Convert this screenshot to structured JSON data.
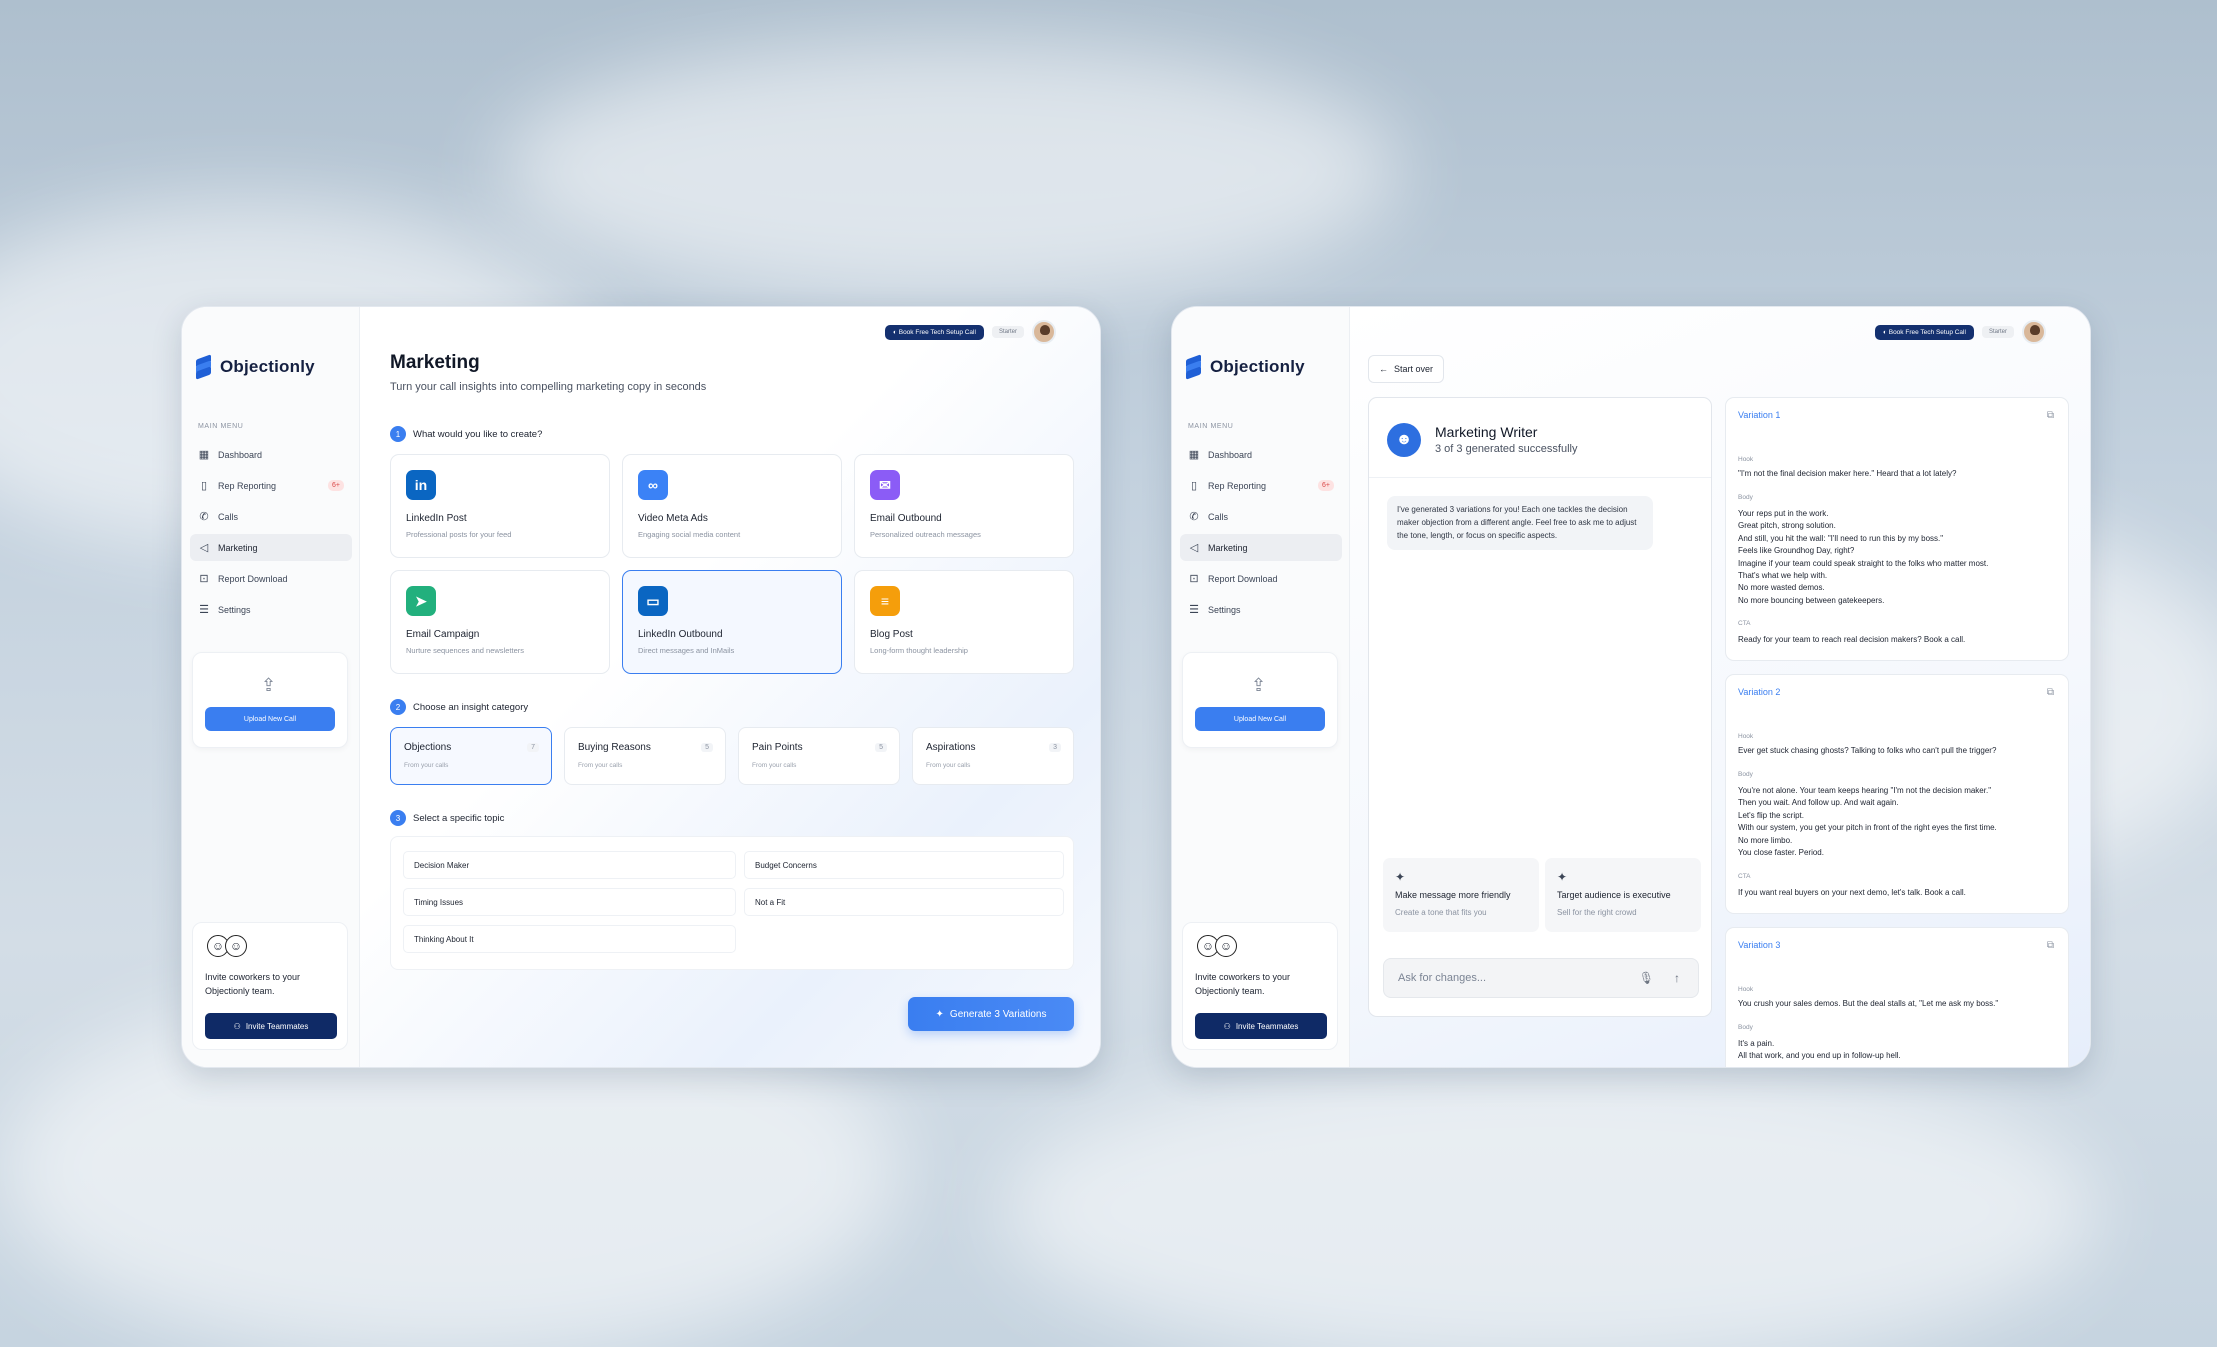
{
  "brand": {
    "name": "Objectionly",
    "accent": "#3a7ef0",
    "navy": "#0f2a66"
  },
  "topbar": {
    "book_call": "Book Free Tech Setup Call",
    "plan": "Starter"
  },
  "sidebar": {
    "menu_title": "MAIN MENU",
    "items": [
      {
        "label": "Dashboard",
        "icon": "grid-icon"
      },
      {
        "label": "Rep Reporting",
        "icon": "book-icon",
        "badge": "6+"
      },
      {
        "label": "Calls",
        "icon": "phone-icon"
      },
      {
        "label": "Marketing",
        "icon": "megaphone-icon",
        "active": true
      },
      {
        "label": "Report Download",
        "icon": "download-icon"
      },
      {
        "label": "Settings",
        "icon": "sliders-icon"
      }
    ],
    "upload_label": "Upload New Call",
    "invite_text": "Invite coworkers to your Objectionly team.",
    "invite_button": "Invite Teammates"
  },
  "marketing": {
    "title": "Marketing",
    "subtitle": "Turn your call insights into compelling marketing copy in seconds",
    "step1": "What would you like to create?",
    "step2": "Choose an insight category",
    "step3": "Select a specific topic",
    "content_types": [
      {
        "title": "LinkedIn Post",
        "desc": "Professional posts for your feed",
        "color": "#0a66c2",
        "glyph": "in"
      },
      {
        "title": "Video Meta Ads",
        "desc": "Engaging social media content",
        "color": "#3b82f6",
        "glyph": "∞"
      },
      {
        "title": "Email Outbound",
        "desc": "Personalized outreach messages",
        "color": "#8b5cf6",
        "glyph": "✉"
      },
      {
        "title": "Email Campaign",
        "desc": "Nurture sequences and newsletters",
        "color": "#22b07d",
        "glyph": "➤"
      },
      {
        "title": "LinkedIn Outbound",
        "desc": "Direct messages and InMails",
        "color": "#0a66c2",
        "glyph": "▭"
      },
      {
        "title": "Blog Post",
        "desc": "Long-form thought leadership",
        "color": "#f59e0b",
        "glyph": "≡"
      }
    ],
    "categories": [
      {
        "title": "Objections",
        "sub": "From your calls",
        "count": "7"
      },
      {
        "title": "Buying Reasons",
        "sub": "From your calls",
        "count": "5"
      },
      {
        "title": "Pain Points",
        "sub": "From your calls",
        "count": "5"
      },
      {
        "title": "Aspirations",
        "sub": "From your calls",
        "count": "3"
      }
    ],
    "topics": [
      "Decision Maker",
      "Budget Concerns",
      "Timing Issues",
      "Not a Fit",
      "Thinking About It"
    ],
    "generate_button": "Generate 3 Variations"
  },
  "writer": {
    "start_over": "Start over",
    "title": "Marketing Writer",
    "status": "3 of 3 generated successfully",
    "message": "I've generated 3 variations for you! Each one tackles the decision maker objection from a different angle. Feel free to ask me to adjust the tone, length, or focus on specific aspects.",
    "suggestions": [
      {
        "title": "Make message more friendly",
        "desc": "Create a tone that fits you"
      },
      {
        "title": "Target audience is executive",
        "desc": "Sell for the right crowd"
      }
    ],
    "ask_placeholder": "Ask for changes...",
    "labels": {
      "hook": "Hook",
      "body": "Body",
      "cta": "CTA"
    },
    "variations": [
      {
        "title": "Variation 1",
        "hook": "\"I'm not the final decision maker here.\" Heard that a lot lately?",
        "body": [
          "Your reps put in the work.",
          "Great pitch, strong solution.",
          "And still, you hit the wall: \"I'll need to run this by my boss.\"",
          "Feels like Groundhog Day, right?",
          "Imagine if your team could speak straight to the folks who matter most.",
          "That's what we help with.",
          "No more wasted demos.",
          "No more bouncing between gatekeepers."
        ],
        "cta": "Ready for your team to reach real decision makers? Book a call."
      },
      {
        "title": "Variation 2",
        "hook": "Ever get stuck chasing ghosts? Talking to folks who can't pull the trigger?",
        "body": [
          "You're not alone. Your team keeps hearing \"I'm not the decision maker.\"",
          "Then you wait. And follow up. And wait again.",
          "Let's flip the script.",
          "With our system, you get your pitch in front of the right eyes the first time.",
          "No more limbo.",
          "You close faster. Period."
        ],
        "cta": "If you want real buyers on your next demo, let's talk. Book a call."
      },
      {
        "title": "Variation 3",
        "hook": "You crush your sales demos. But the deal stalls at, \"Let me ask my boss.\"",
        "body": [
          "It's a pain.",
          "All that work, and you end up in follow-up hell."
        ],
        "cta": ""
      }
    ]
  }
}
